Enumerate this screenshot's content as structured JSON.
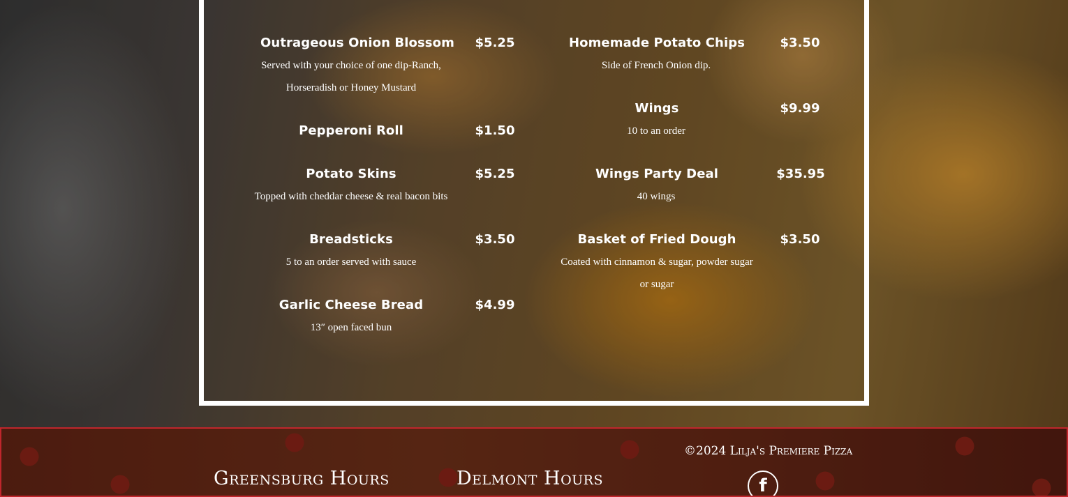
{
  "menu": {
    "left": [
      {
        "name": "Outrageous Onion Blossom",
        "price": "$5.25",
        "desc": [
          "Served with your choice of one dip-Ranch,",
          "Horseradish or Honey Mustard"
        ]
      },
      {
        "name": "Pepperoni Roll",
        "price": "$1.50",
        "desc": []
      },
      {
        "name": "Potato Skins",
        "price": "$5.25",
        "desc": [
          "Topped with cheddar cheese & real bacon bits"
        ]
      },
      {
        "name": "Breadsticks",
        "price": "$3.50",
        "desc": [
          "5 to an order served with sauce"
        ]
      },
      {
        "name": "Garlic Cheese Bread",
        "price": "$4.99",
        "desc": [
          "13″ open faced bun"
        ]
      }
    ],
    "right": [
      {
        "name": "Homemade Potato Chips",
        "price": "$3.50",
        "desc": [
          "Side of French Onion dip."
        ]
      },
      {
        "name": "Wings",
        "price": "$9.99",
        "desc": [
          "10 to an order"
        ]
      },
      {
        "name": "Wings Party Deal",
        "price": "$35.95",
        "desc": [
          "40 wings"
        ]
      },
      {
        "name": "Basket of Fried Dough",
        "price": "$3.50",
        "desc": [
          "Coated with cinnamon & sugar, powder sugar",
          "or sugar"
        ]
      }
    ]
  },
  "footer": {
    "greensburg_hours": "Greensburg Hours",
    "delmont_hours": "Delmont Hours",
    "copyright": "©2024 Lilja's Premiere Pizza",
    "facebook_icon": "facebook-icon",
    "accent": "#c0262c"
  }
}
